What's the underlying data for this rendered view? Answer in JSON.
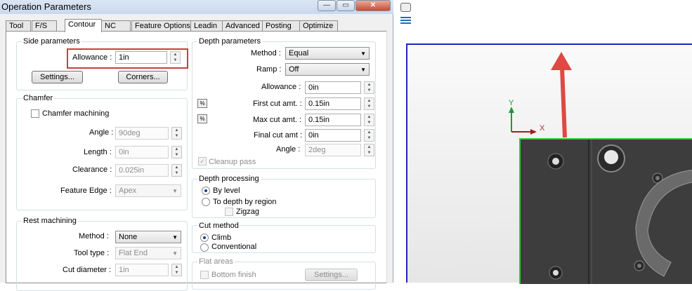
{
  "title": "Operation Parameters",
  "tabs": [
    "Tool",
    "F/S",
    "Contour",
    "NC",
    "Feature Options",
    "Leadin",
    "Advanced",
    "Posting",
    "Optimize"
  ],
  "side": {
    "title": "Side parameters",
    "allowance_label": "Allowance :",
    "allowance_value": "1in",
    "settings_btn": "Settings...",
    "corners_btn": "Corners..."
  },
  "chamfer": {
    "title": "Chamfer",
    "machining_label": "Chamfer machining",
    "angle_label": "Angle :",
    "angle_value": "90deg",
    "length_label": "Length :",
    "length_value": "0in",
    "clearance_label": "Clearance :",
    "clearance_value": "0.025in",
    "edge_label": "Feature Edge :",
    "edge_value": "Apex"
  },
  "rest": {
    "title": "Rest machining",
    "method_label": "Method :",
    "method_value": "None",
    "tooltype_label": "Tool type :",
    "tooltype_value": "Flat End",
    "cutdia_label": "Cut diameter :",
    "cutdia_value": "1in"
  },
  "depth": {
    "title": "Depth parameters",
    "method_label": "Method :",
    "method_value": "Equal",
    "ramp_label": "Ramp :",
    "ramp_value": "Off",
    "allowance_label": "Allowance :",
    "allowance_value": "0in",
    "first_label": "First cut amt. :",
    "first_value": "0.15in",
    "max_label": "Max cut amt. :",
    "max_value": "0.15in",
    "final_label": "Final cut amt :",
    "final_value": "0in",
    "angle_label": "Angle :",
    "angle_value": "2deg",
    "cleanup_label": "Cleanup pass"
  },
  "processing": {
    "title": "Depth processing",
    "bylevel": "By level",
    "byregion": "To depth by region",
    "zigzag": "Zigzag"
  },
  "cutmethod": {
    "title": "Cut method",
    "climb": "Climb",
    "conventional": "Conventional"
  },
  "flat": {
    "title": "Flat areas",
    "bottom": "Bottom finish",
    "settings_btn": "Settings..."
  },
  "axes": {
    "y": "Y",
    "x": "X"
  }
}
